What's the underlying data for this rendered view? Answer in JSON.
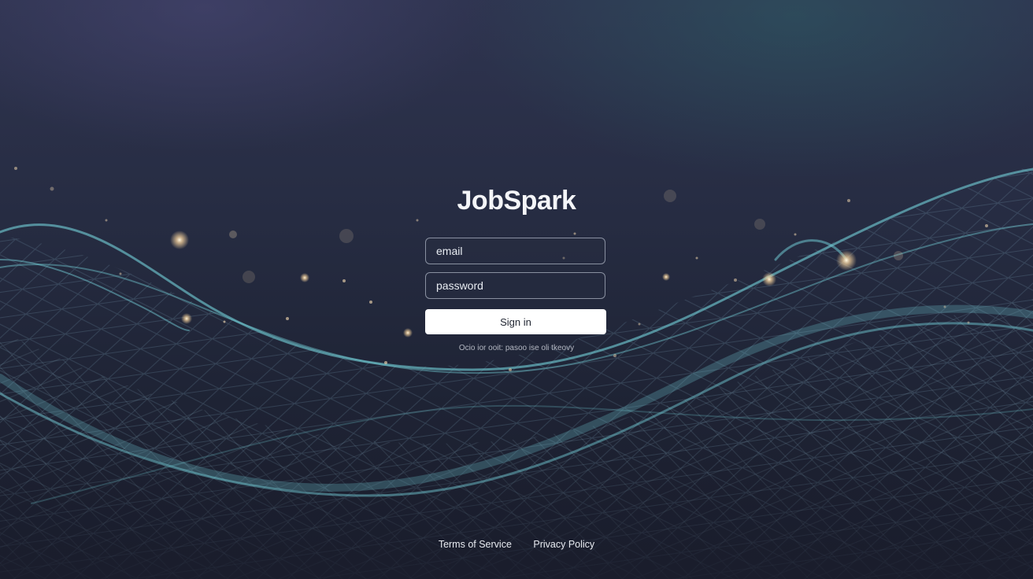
{
  "app": {
    "brand": "JobSpark"
  },
  "login": {
    "email_placeholder": "email",
    "password_placeholder": "password",
    "signin_label": "Sign in",
    "helper_text": "Ocio  ior  ooit: pasoo ise oli tkeovy"
  },
  "footer": {
    "terms_label": "Terms of Service",
    "privacy_label": "Privacy Policy"
  },
  "theme": {
    "background_top": "#2f3450",
    "background_bottom": "#1a1d2c",
    "wave_color": "#6fc6cf",
    "button_color": "#ffffff"
  }
}
